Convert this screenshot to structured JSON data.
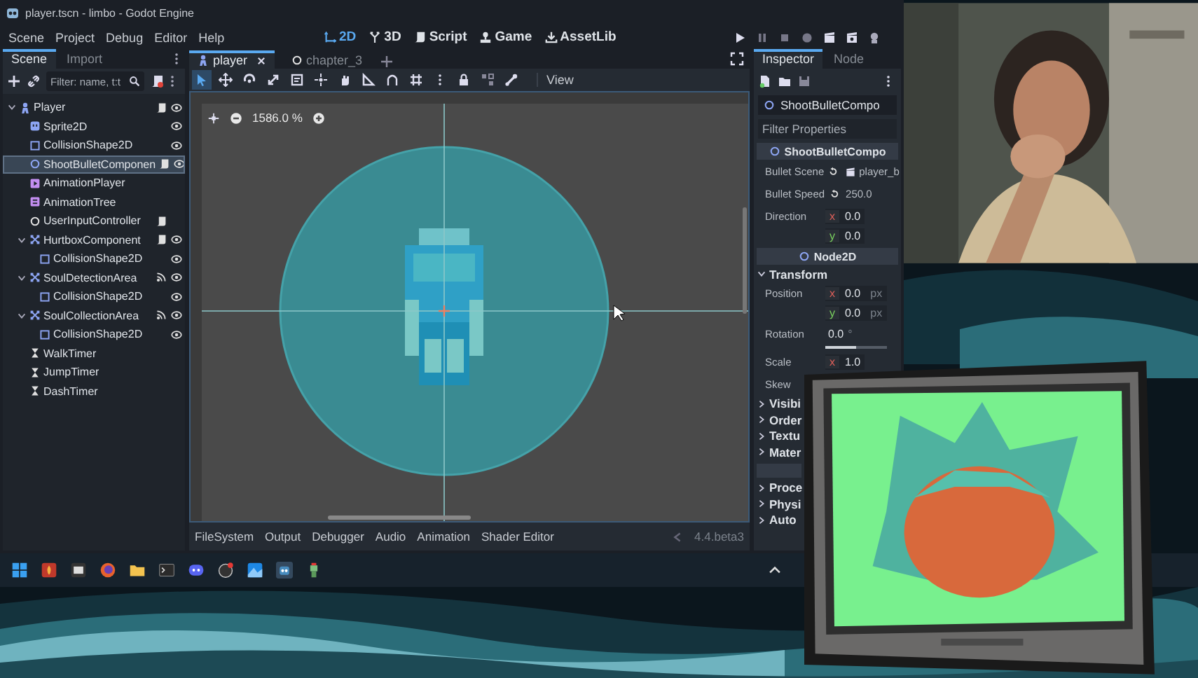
{
  "window": {
    "title": "player.tscn - limbo - Godot Engine"
  },
  "menu": [
    "Scene",
    "Project",
    "Debug",
    "Editor",
    "Help"
  ],
  "workspaces": [
    {
      "label": "2D",
      "kind": "canvas",
      "selected": true
    },
    {
      "label": "3D",
      "kind": "spatial",
      "selected": false
    },
    {
      "label": "Script",
      "kind": "script",
      "selected": false
    },
    {
      "label": "Game",
      "kind": "game",
      "selected": false
    },
    {
      "label": "AssetLib",
      "kind": "assetlib",
      "selected": false
    }
  ],
  "scene_dock": {
    "tabs": [
      {
        "label": "Scene",
        "selected": true
      },
      {
        "label": "Import",
        "selected": false
      }
    ],
    "filter": {
      "placeholder": "Filter: name, t:t"
    },
    "tree": [
      {
        "label": "Player",
        "kind": "character",
        "selected": false,
        "expanded": true,
        "script": true,
        "visible": true,
        "children": [
          {
            "label": "Sprite2D",
            "kind": "sprite",
            "selected": false,
            "visible": true
          },
          {
            "label": "CollisionShape2D",
            "kind": "shape",
            "selected": false,
            "visible": true
          },
          {
            "label": "ShootBulletComponen",
            "kind": "node2d",
            "selected": true,
            "script": true,
            "visible": true
          },
          {
            "label": "AnimationPlayer",
            "kind": "animplayer",
            "selected": false
          },
          {
            "label": "AnimationTree",
            "kind": "animtree",
            "selected": false
          },
          {
            "label": "UserInputController",
            "kind": "node",
            "selected": false,
            "script": true
          },
          {
            "label": "HurtboxComponent",
            "kind": "area",
            "selected": false,
            "expanded": true,
            "script": true,
            "visible": true,
            "children": [
              {
                "label": "CollisionShape2D",
                "kind": "shape",
                "selected": false,
                "visible": true
              }
            ]
          },
          {
            "label": "SoulDetectionArea",
            "kind": "area",
            "selected": false,
            "expanded": true,
            "signals": true,
            "visible": true,
            "children": [
              {
                "label": "CollisionShape2D",
                "kind": "shape",
                "selected": false,
                "visible": true
              }
            ]
          },
          {
            "label": "SoulCollectionArea",
            "kind": "area",
            "selected": false,
            "expanded": true,
            "signals": true,
            "visible": true,
            "children": [
              {
                "label": "CollisionShape2D",
                "kind": "shape",
                "selected": false,
                "visible": true
              }
            ]
          },
          {
            "label": "WalkTimer",
            "kind": "timer",
            "selected": false
          },
          {
            "label": "JumpTimer",
            "kind": "timer",
            "selected": false
          },
          {
            "label": "DashTimer",
            "kind": "timer",
            "selected": false
          }
        ]
      }
    ]
  },
  "editor": {
    "tabs": [
      {
        "label": "player",
        "kind": "scene",
        "selected": true
      },
      {
        "label": "chapter_3",
        "kind": "node",
        "selected": false
      }
    ],
    "zoom": "1586.0 %",
    "view_menu": "View",
    "bottom_tabs": [
      "FileSystem",
      "Output",
      "Debugger",
      "Audio",
      "Animation",
      "Shader Editor"
    ],
    "version": "4.4.beta3"
  },
  "inspector": {
    "tabs": [
      {
        "label": "Inspector",
        "selected": true
      },
      {
        "label": "Node",
        "selected": false
      }
    ],
    "object": "ShootBulletCompo",
    "filter": {
      "placeholder": "Filter Properties"
    },
    "rows": [
      {
        "kind": "header",
        "label": "ShootBulletCompo"
      },
      {
        "kind": "resource",
        "label": "Bullet Scene",
        "value": "player_b",
        "revert": true
      },
      {
        "kind": "number",
        "label": "Bullet Speed",
        "value": "250.0",
        "revert": true
      },
      {
        "kind": "vector",
        "label": "Direction",
        "components": [
          {
            "axis": "x",
            "value": "0.0"
          },
          {
            "axis": "y",
            "value": "0.0"
          }
        ]
      },
      {
        "kind": "header",
        "label": "Node2D"
      },
      {
        "kind": "group",
        "label": "Transform",
        "expanded": true
      },
      {
        "kind": "vector",
        "label": "Position",
        "components": [
          {
            "axis": "x",
            "value": "0.0",
            "unit": "px"
          },
          {
            "axis": "y",
            "value": "0.0",
            "unit": "px"
          }
        ]
      },
      {
        "kind": "slider",
        "label": "Rotation",
        "value": "0.0",
        "unit": "°",
        "level": 0.5
      },
      {
        "kind": "vector",
        "label": "Scale",
        "components": [
          {
            "axis": "x",
            "value": "1.0"
          }
        ]
      },
      {
        "kind": "number",
        "label": "Skew"
      },
      {
        "kind": "group",
        "label": "Visibi",
        "expanded": false
      },
      {
        "kind": "group",
        "label": "Order",
        "expanded": false
      },
      {
        "kind": "group",
        "label": "Textu",
        "expanded": false
      },
      {
        "kind": "group",
        "label": "Mater",
        "expanded": false
      },
      {
        "kind": "band"
      },
      {
        "kind": "group",
        "label": "Proce",
        "expanded": false
      },
      {
        "kind": "group",
        "label": "Physi",
        "expanded": false
      },
      {
        "kind": "group",
        "label": "Auto",
        "expanded": false
      }
    ]
  }
}
